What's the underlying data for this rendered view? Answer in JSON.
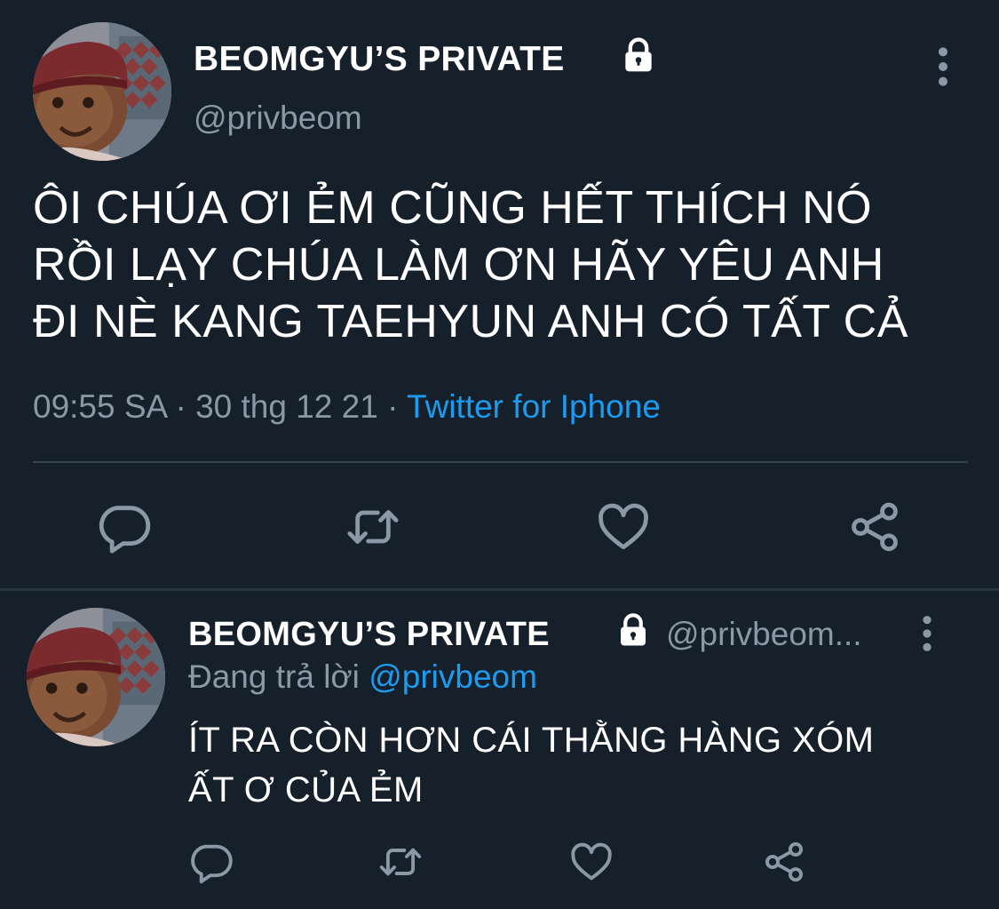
{
  "colors": {
    "background": "#15202b",
    "text": "#ffffff",
    "secondary": "#8b98a5",
    "link": "#1d9bf0",
    "divider": "#38444d"
  },
  "main_tweet": {
    "avatar_icon": "avatar-photo",
    "display_name": "BEOMGYU’S PRIVATE",
    "lock_icon": "lock-icon",
    "handle": "@privbeom",
    "more_icon": "more-vertical-icon",
    "text": "ÔI CHÚA ƠI ẺM CŨNG HẾT THÍCH NÓ\nRỒI LẠY CHÚA LÀM ƠN HÃY YÊU ANH\nĐI NÈ KANG TAEHYUN ANH CÓ TẤT CẢ",
    "time": "09:55 SA",
    "sep1": " · ",
    "date": "30 thg 12 21",
    "sep2": " · ",
    "source": "Twitter for Iphone",
    "actions": [
      "reply-icon",
      "retweet-icon",
      "like-icon",
      "share-icon"
    ]
  },
  "reply_tweet": {
    "avatar_icon": "avatar-photo",
    "display_name": "BEOMGYU’S PRIVATE",
    "lock_icon": "lock-icon",
    "handle": "@privbeom...",
    "more_icon": "more-vertical-icon",
    "replying_label": "Đang trả lời",
    "replying_to": "@privbeom",
    "text": "ÍT RA CÒN HƠN CÁI THẰNG HÀNG XÓM\nẤT Ơ CỦA ẺM",
    "actions": [
      "reply-icon",
      "retweet-icon",
      "like-icon",
      "share-icon"
    ]
  }
}
